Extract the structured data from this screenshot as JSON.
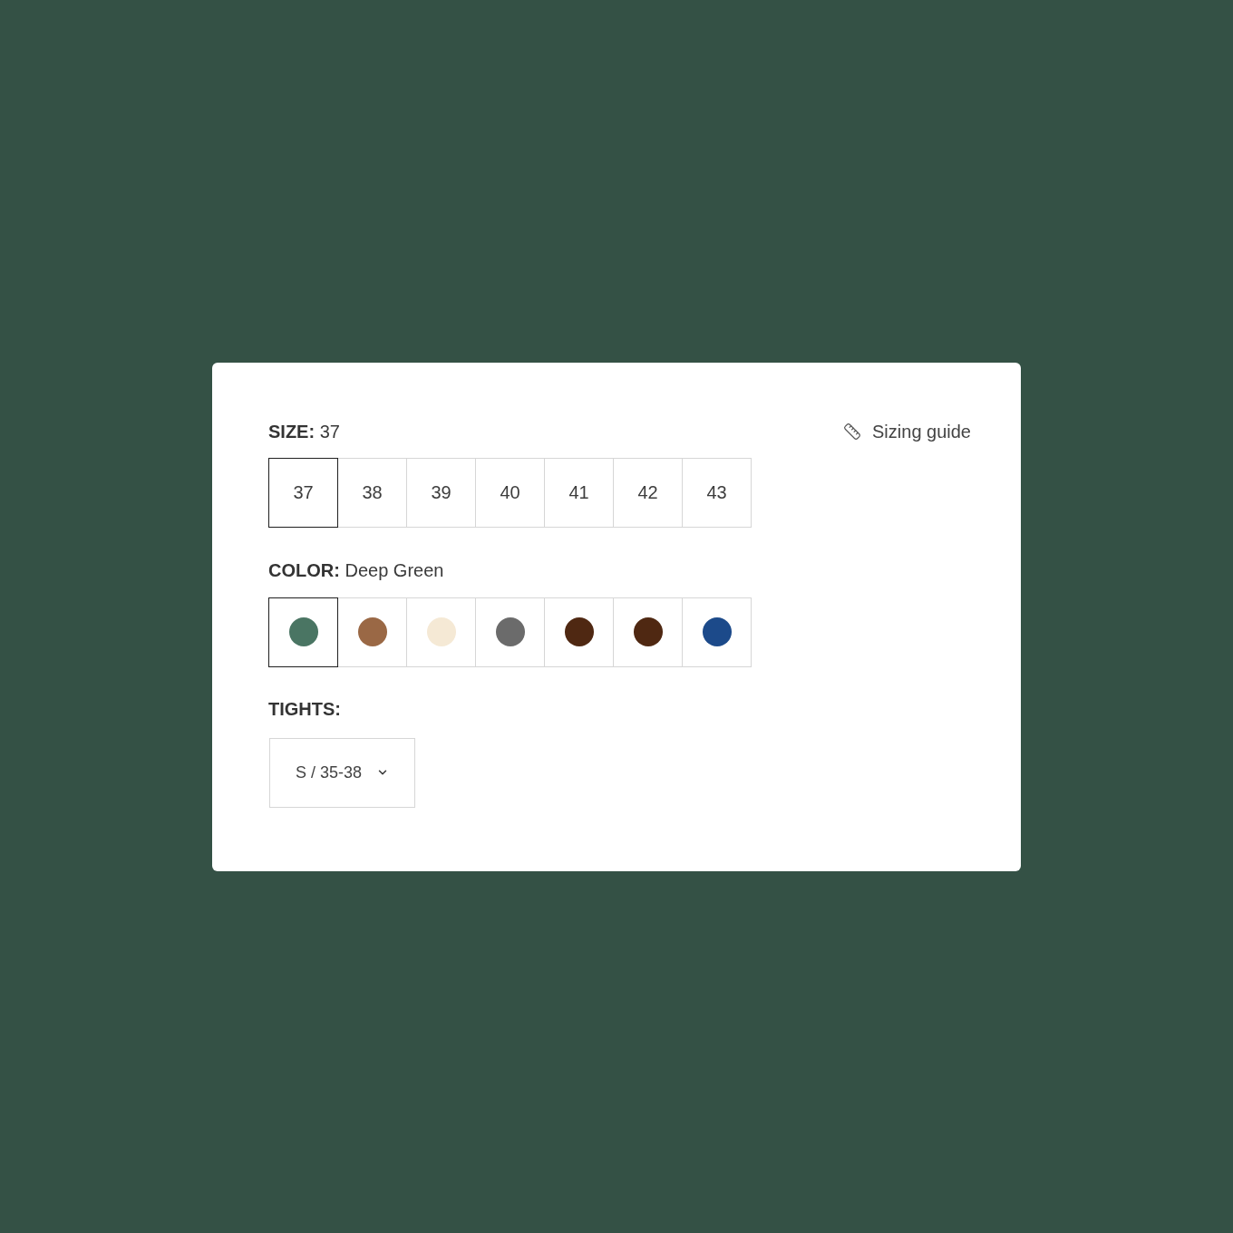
{
  "size": {
    "label": "SIZE:",
    "value": "37",
    "options": [
      {
        "label": "37",
        "selected": true
      },
      {
        "label": "38",
        "selected": false
      },
      {
        "label": "39",
        "selected": false
      },
      {
        "label": "40",
        "selected": false
      },
      {
        "label": "41",
        "selected": false
      },
      {
        "label": "42",
        "selected": false
      },
      {
        "label": "43",
        "selected": false
      }
    ]
  },
  "sizing_guide": {
    "label": "Sizing guide"
  },
  "color": {
    "label": "COLOR:",
    "value": "Deep Green",
    "options": [
      {
        "color": "#4a7563",
        "selected": true
      },
      {
        "color": "#9a6845",
        "selected": false
      },
      {
        "color": "#f5e9d5",
        "selected": false
      },
      {
        "color": "#6b6b6b",
        "selected": false
      },
      {
        "color": "#4f2812",
        "selected": false
      },
      {
        "color": "#4f2812",
        "selected": false
      },
      {
        "color": "#1c4a8a",
        "selected": false
      }
    ]
  },
  "tights": {
    "label": "TIGHTS:",
    "select": {
      "value": "S / 35-38"
    }
  }
}
